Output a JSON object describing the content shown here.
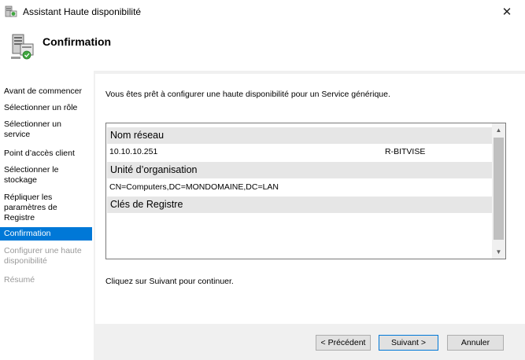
{
  "window": {
    "title": "Assistant Haute disponibilité",
    "icon": "cluster-wizard-icon",
    "close_glyph": "✕"
  },
  "header": {
    "title": "Confirmation",
    "icon": "cluster-wizard-icon"
  },
  "nav": {
    "items": [
      {
        "label": "Avant de commencer",
        "state": "normal"
      },
      {
        "label": "Sélectionner un rôle",
        "state": "normal"
      },
      {
        "label": "Sélectionner un service",
        "state": "normal"
      },
      {
        "label": "Point d’accès client",
        "state": "normal"
      },
      {
        "label": "Sélectionner le stockage",
        "state": "normal"
      },
      {
        "label": "Répliquer les paramètres de Registre",
        "state": "normal"
      },
      {
        "label": "Confirmation",
        "state": "active"
      },
      {
        "label": "Configurer une haute disponibilité",
        "state": "disabled"
      },
      {
        "label": "Résumé",
        "state": "disabled"
      }
    ]
  },
  "content": {
    "intro": "Vous êtes prêt à configurer une haute disponibilité pour un Service générique.",
    "groups": [
      {
        "header": "Nom réseau",
        "rows": [
          {
            "col1": "10.10.10.251",
            "col2": "R-BITVISE"
          }
        ]
      },
      {
        "header": "Unité d’organisation",
        "rows": [
          {
            "col1": "CN=Computers,DC=MONDOMAINE,DC=LAN",
            "col2": ""
          }
        ]
      },
      {
        "header": "Clés de Registre",
        "rows": []
      }
    ],
    "footer": "Cliquez sur Suivant pour continuer."
  },
  "buttons": {
    "previous": "< Précédent",
    "next": "Suivant >",
    "cancel": "Annuler"
  },
  "colors": {
    "accent": "#0078d7",
    "group_header_bg": "#e6e6e6",
    "panel_bg": "#f0f0f0"
  }
}
